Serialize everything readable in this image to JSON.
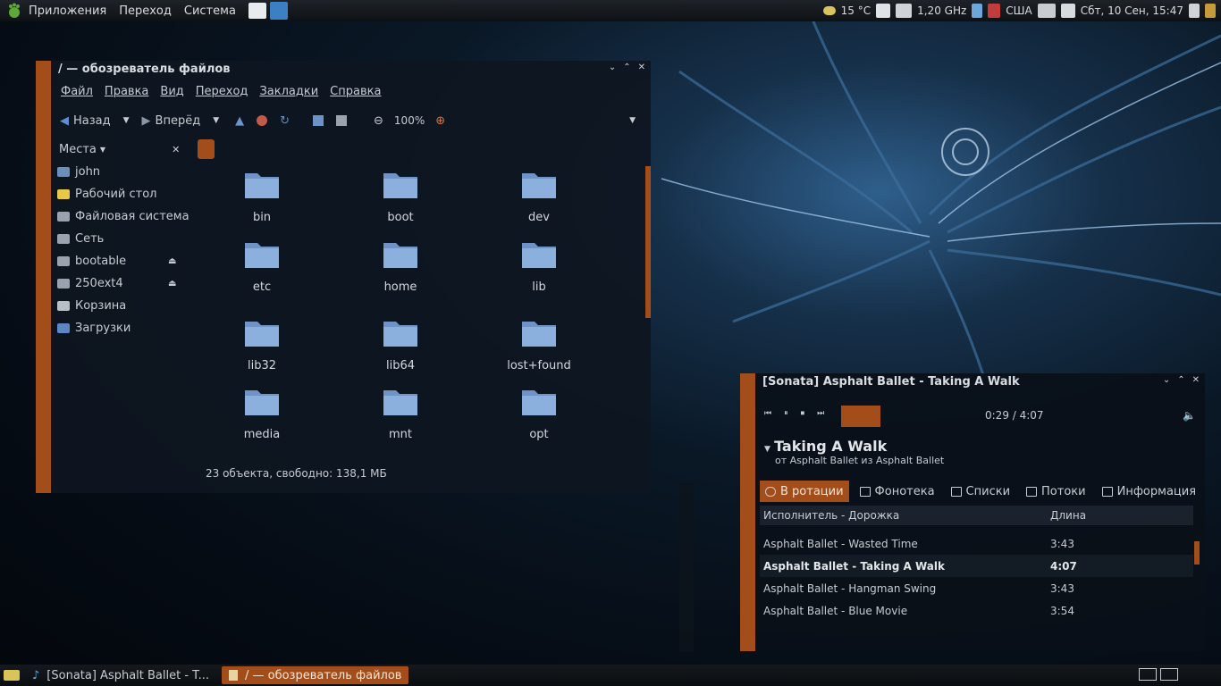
{
  "top_panel": {
    "menus": [
      "Приложения",
      "Переход",
      "Система"
    ],
    "weather": "15 °C",
    "cpu": "1,20 GHz",
    "keyboard": "США",
    "clock": "Сбт, 10 Сен, 15:47"
  },
  "file_manager": {
    "title": "/ — обозреватель файлов",
    "menu": [
      "Файл",
      "Правка",
      "Вид",
      "Переход",
      "Закладки",
      "Справка"
    ],
    "toolbar": {
      "back": "Назад",
      "forward": "Вперёд",
      "zoom": "100%"
    },
    "sidebar": {
      "header": "Места",
      "items": [
        {
          "label": "john",
          "icon": "home-folder-icon",
          "color": "#6b8fb8"
        },
        {
          "label": "Рабочий стол",
          "icon": "desktop-folder-icon",
          "color": "#e8c84a"
        },
        {
          "label": "Файловая система",
          "icon": "drive-icon",
          "color": "#9aa3ad"
        },
        {
          "label": "Сеть",
          "icon": "network-icon",
          "color": "#9aa3ad"
        },
        {
          "label": "bootable",
          "icon": "drive-icon",
          "color": "#9aa3ad",
          "eject": true
        },
        {
          "label": "250ext4",
          "icon": "drive-icon",
          "color": "#9aa3ad",
          "eject": true
        },
        {
          "label": "Корзина",
          "icon": "trash-icon",
          "color": "#b8bfc6"
        },
        {
          "label": "Загрузки",
          "icon": "downloads-folder-icon",
          "color": "#5d87c4"
        }
      ]
    },
    "folders": [
      "bin",
      "boot",
      "dev",
      "etc",
      "home",
      "lib",
      "lib32",
      "lib64",
      "lost+found",
      "media",
      "mnt",
      "opt"
    ],
    "status": "23 объекта, свободно: 138,1 МБ"
  },
  "sonata": {
    "title": "[Sonata] Asphalt Ballet - Taking A Walk",
    "time": "0:29 / 4:07",
    "song_title": "Taking A Walk",
    "song_sub": "от Asphalt Ballet из Asphalt Ballet",
    "tabs": [
      "В ротации",
      "Фонотека",
      "Списки",
      "Потоки",
      "Информация"
    ],
    "columns": [
      "Исполнитель - Дорожка",
      "Длина"
    ],
    "rows": [
      {
        "track": "Asphalt Ballet - Wasted Time",
        "length": "3:43"
      },
      {
        "track": "Asphalt Ballet - Taking A Walk",
        "length": "4:07"
      },
      {
        "track": "Asphalt Ballet - Hangman Swing",
        "length": "3:43"
      },
      {
        "track": "Asphalt Ballet - Blue Movie",
        "length": "3:54"
      }
    ]
  },
  "taskbar": {
    "tasks": [
      "[Sonata] Asphalt Ballet - T...",
      "/ — обозреватель файлов"
    ]
  },
  "colors": {
    "accent": "#a34d1a",
    "folder": "#6f93c7"
  }
}
